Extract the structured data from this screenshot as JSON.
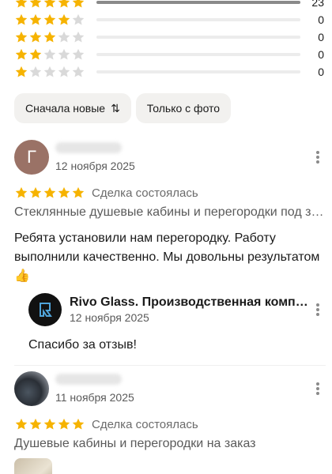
{
  "colors": {
    "star": "#f6b300",
    "star_empty": "#d9d9d9"
  },
  "distribution": [
    {
      "stars": 5,
      "count": "23",
      "fraction": 1.0
    },
    {
      "stars": 4,
      "count": "0",
      "fraction": 0
    },
    {
      "stars": 3,
      "count": "0",
      "fraction": 0
    },
    {
      "stars": 2,
      "count": "0",
      "fraction": 0
    },
    {
      "stars": 1,
      "count": "0",
      "fraction": 0
    }
  ],
  "filters": {
    "sort_label": "Сначала новые",
    "sort_icon": "⇅",
    "photo_label": "Только с фото"
  },
  "reviews": [
    {
      "avatar_letter": "Г",
      "date": "12 ноября 2025",
      "rating": 5,
      "deal": "Сделка состоялась",
      "service": "Стеклянные душевые кабины и перегородки под заказ",
      "text": "Ребята установили нам перегородку. Работу выполнили качественно. Мы довольны результатом 👍",
      "reply": {
        "name": "Rivo Glass. Производственная компания",
        "date": "12 ноября 2025",
        "text": "Спасибо за отзыв!"
      }
    },
    {
      "avatar_letter": "",
      "date": "11 ноября 2025",
      "rating": 5,
      "deal": "Сделка состоялась",
      "service": "Душевые кабины и перегородки на заказ"
    }
  ]
}
